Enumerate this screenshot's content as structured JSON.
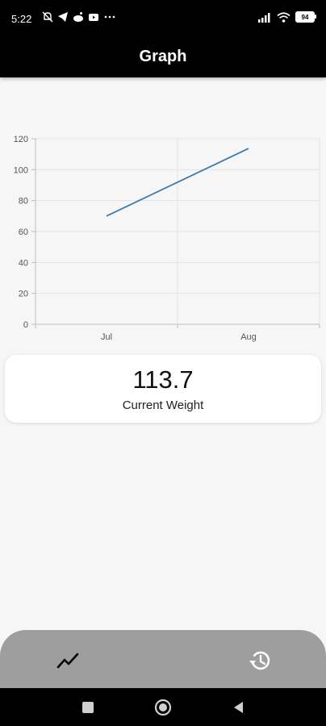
{
  "status_bar": {
    "time": "5:22",
    "battery": "94",
    "left_icons": [
      "muted-notification-icon",
      "telegram-icon",
      "reddit-icon",
      "youtube-icon",
      "more-dots-icon"
    ],
    "right_icons": [
      "signal-icon",
      "wifi-icon",
      "battery-icon"
    ]
  },
  "app_bar": {
    "title": "Graph"
  },
  "chart_data": {
    "type": "line",
    "title": "",
    "xlabel": "",
    "ylabel": "",
    "categories": [
      "Jul",
      "Aug"
    ],
    "ylim": [
      0,
      120
    ],
    "y_ticks": [
      0,
      20,
      40,
      60,
      80,
      100,
      120
    ],
    "x_ticks": [
      "Jul",
      "Aug"
    ],
    "grid": true,
    "series": [
      {
        "color": "#3d7cae",
        "points": [
          {
            "x": "Jul",
            "y": 70
          },
          {
            "x": "Aug",
            "y": 113.7
          }
        ]
      }
    ]
  },
  "weight_card": {
    "value": "113.7",
    "label": "Current Weight"
  },
  "bottom_nav": {
    "items": [
      {
        "icon": "trending-graph-icon",
        "active": true
      },
      {
        "icon": "history-icon",
        "active": false
      }
    ]
  },
  "system_nav": {
    "buttons": [
      "recents-icon",
      "home-icon",
      "back-icon"
    ]
  }
}
